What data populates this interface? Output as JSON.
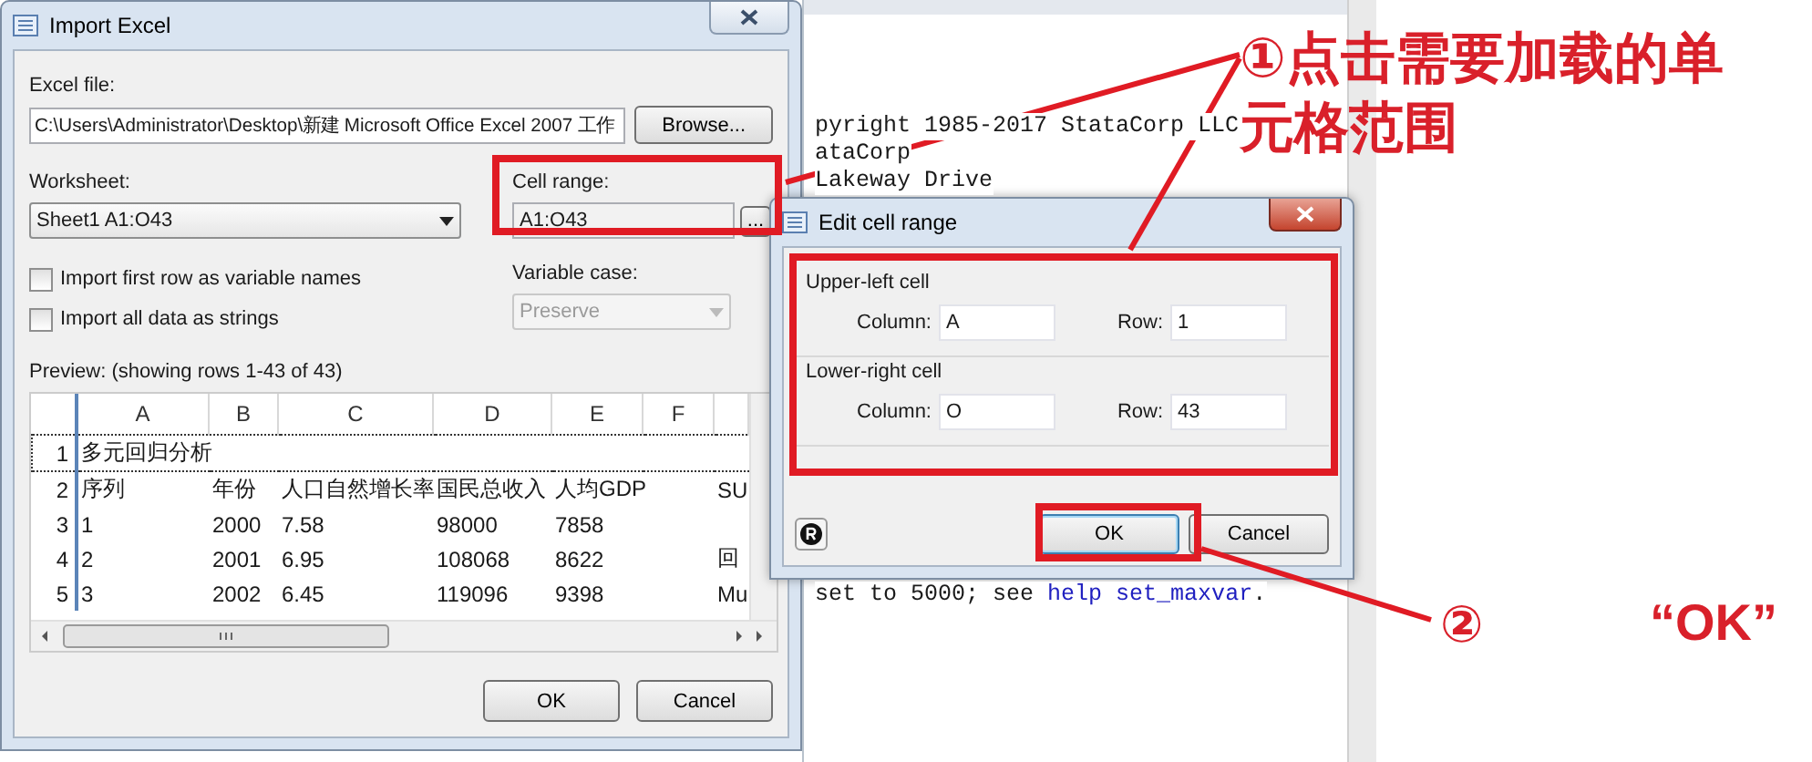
{
  "results_window": {
    "lines": [
      {
        "text": "pyright 1985-2017 StataCorp LLC"
      },
      {
        "text": "ataCorp"
      },
      {
        "text": "Lakeway Drive"
      }
    ],
    "bottom_line": {
      "text": "set to 5000; see",
      "link": "help set_maxvar",
      "after": "."
    }
  },
  "import_dialog": {
    "title": "Import Excel",
    "excel_file": {
      "label": "Excel file:",
      "value": "C:\\Users\\Administrator\\Desktop\\新建 Microsoft Office Excel 2007 工作"
    },
    "browse_button": "Browse...",
    "worksheet": {
      "label": "Worksheet:",
      "value": "Sheet1 A1:O43"
    },
    "cell_range": {
      "label": "Cell range:",
      "value": "A1:O43",
      "button": "..."
    },
    "checkboxes": [
      {
        "label": "Import first row as variable names",
        "checked": false
      },
      {
        "label": "Import all data as strings",
        "checked": false
      }
    ],
    "variable_case": {
      "label": "Variable case:",
      "value": "Preserve",
      "disabled": true
    },
    "preview": {
      "caption": "Preview: (showing rows 1-43 of 43)",
      "columns": [
        "A",
        "B",
        "C",
        "D",
        "E",
        "F"
      ],
      "rows": [
        {
          "number": "1",
          "selected": true,
          "cells": [
            "多元回归分析",
            null,
            null,
            null,
            null,
            null,
            null
          ]
        },
        {
          "number": "2",
          "selected": false,
          "cells": [
            "序列",
            "年份",
            "人口自然增长率",
            "国民总收入",
            "人均GDP",
            null,
            "SU"
          ]
        },
        {
          "number": "3",
          "selected": false,
          "cells": [
            "1",
            "2000",
            "7.58",
            "98000",
            "7858",
            null,
            null
          ]
        },
        {
          "number": "4",
          "selected": false,
          "cells": [
            "2",
            "2001",
            "6.95",
            "108068",
            "8622",
            null,
            "回"
          ]
        },
        {
          "number": "5",
          "selected": false,
          "cells": [
            "3",
            "2002",
            "6.45",
            "119096",
            "9398",
            null,
            "Mu"
          ]
        }
      ]
    },
    "buttons": [
      "OK",
      "Cancel"
    ]
  },
  "edit_dialog": {
    "title": "Edit cell range",
    "groups": [
      {
        "title": "Upper-left cell",
        "column_label": "Column:",
        "column": "A",
        "row_label": "Row:",
        "row": "1"
      },
      {
        "title": "Lower-right cell",
        "column_label": "Column:",
        "column": "O",
        "row_label": "Row:",
        "row": "43"
      }
    ],
    "buttons": [
      "OK",
      "Cancel"
    ]
  },
  "callouts": [
    {
      "lines": [
        "①点击需要加载的单",
        "元格范围"
      ]
    },
    {
      "lines": [
        "②"
      ]
    },
    {
      "lines": [
        "“OK”"
      ]
    }
  ]
}
